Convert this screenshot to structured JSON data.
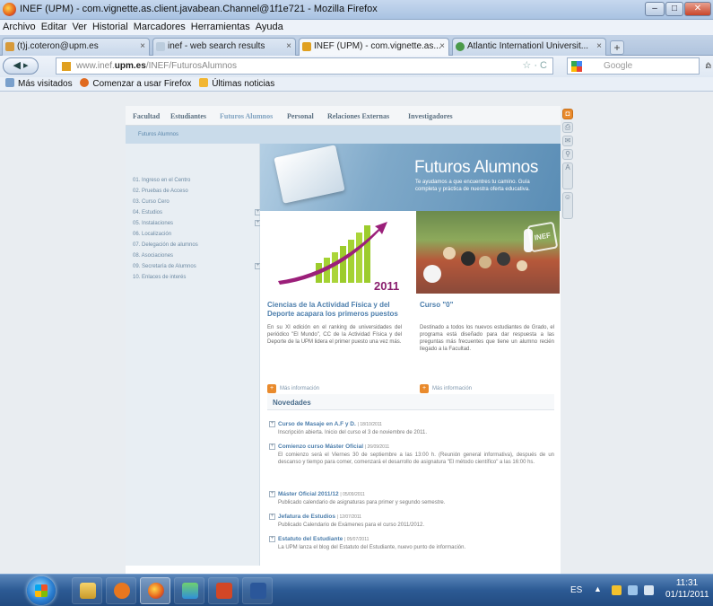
{
  "window": {
    "title": "INEF (UPM) - com.vignette.as.client.javabean.Channel@1f1e721 - Mozilla Firefox",
    "min": "–",
    "max": "□",
    "close": "✕"
  },
  "menu": [
    "Archivo",
    "Editar",
    "Ver",
    "Historial",
    "Marcadores",
    "Herramientas",
    "Ayuda"
  ],
  "tabs": [
    {
      "label": "(t)j.coteron@upm.es",
      "active": false
    },
    {
      "label": "inef - web search results",
      "active": false
    },
    {
      "label": "INEF (UPM) - com.vignette.as...",
      "active": true
    },
    {
      "label": "Atlantic Internationl Universit...",
      "active": false
    }
  ],
  "newtab": "+",
  "address": {
    "prefix": "www.inef.",
    "domain": "upm.es",
    "path": "/INEF/FuturosAlumnos",
    "star": "☆ · C"
  },
  "search": {
    "placeholder": "Google"
  },
  "bookmarks": [
    "Más visitados",
    "Comenzar a usar Firefox",
    "Últimas noticias"
  ],
  "site": {
    "nav": [
      "Facultad",
      "Estudiantes",
      "Futuros Alumnos",
      "Personal",
      "Relaciones Externas",
      "Investigadores"
    ],
    "breadcrumb": "Futuros Alumnos",
    "left_menu": [
      {
        "label": "01. Ingreso en el Centro",
        "plus": false
      },
      {
        "label": "02. Pruebas de Acceso",
        "plus": false
      },
      {
        "label": "03. Curso Cero",
        "plus": false
      },
      {
        "label": "04. Estudios",
        "plus": true
      },
      {
        "label": "05. Instalaciones",
        "plus": true
      },
      {
        "label": "06. Localización",
        "plus": false
      },
      {
        "label": "07. Delegación de alumnos",
        "plus": false
      },
      {
        "label": "08. Asociaciones",
        "plus": false
      },
      {
        "label": "09. Secretaría de Alumnos",
        "plus": true
      },
      {
        "label": "10. Enlaces de interés",
        "plus": false
      }
    ],
    "hero": {
      "title": "Futuros Alumnos",
      "subtitle": "Te ayudamos a que encuentres tu camino. Guía completa y práctica de nuestra oferta educativa."
    },
    "chart_year": "2011",
    "img2_logo": "INEF",
    "feature1": {
      "title": "Ciencias de la Actividad Física y del Deporte acapara los primeros puestos",
      "body": "En su XI edición en el ranking de universidades del periódico \"El Mundo\", CC de la Actividad Física y del Deporte de la UPM lidera el primer puesto una vez más.",
      "more": "Más información"
    },
    "feature2": {
      "title": "Curso \"0\"",
      "body": "Destinado a todos los nuevos estudiantes de Grado, el programa está diseñado para dar respuesta a las preguntas más frecuentes que tiene un alumno recién llegado a la Facultad.",
      "more": "Más información"
    },
    "novedades_title": "Novedades",
    "novedades": [
      {
        "title": "Curso de Masaje en A.F y D.",
        "date": "| 18/10/2011",
        "body": "Inscripción abierta. Inicio del curso el 3 de noviembre de 2011."
      },
      {
        "title": "Comienzo curso Máster Oficial",
        "date": "| 26/09/2011",
        "body": "El comienzo será el Viernes 30 de septiembre a las 13:00 h. (Reunión general informativa), después de un descanso y tiempo para comer, comenzará el desarrollo de asignatura \"El método científico\" a las 16:00 hs."
      },
      {
        "title": "Máster Oficial 2011/12",
        "date": "| 05/09/2011",
        "body": "Publicado calendario de asignaturas para primer y segundo semestre."
      },
      {
        "title": "Jefatura de Estudios",
        "date": "| 12/07/2011",
        "body": "Publicado Calendario de Exámenes para el curso 2011/2012."
      },
      {
        "title": "Estatuto del Estudiante",
        "date": "| 05/07/2011",
        "body": "La UPM lanza el blog del Estatuto del Estudiante, nuevo punto de información."
      }
    ]
  },
  "taskbar": {
    "lang": "ES",
    "arrow": "▲",
    "time": "11:31",
    "date": "01/11/2011"
  },
  "colors": {
    "accent": "#4c7eac",
    "hero_blue": "#7fa9c9",
    "orange": "#e98a2c",
    "taskbar": "#2c5a94"
  }
}
